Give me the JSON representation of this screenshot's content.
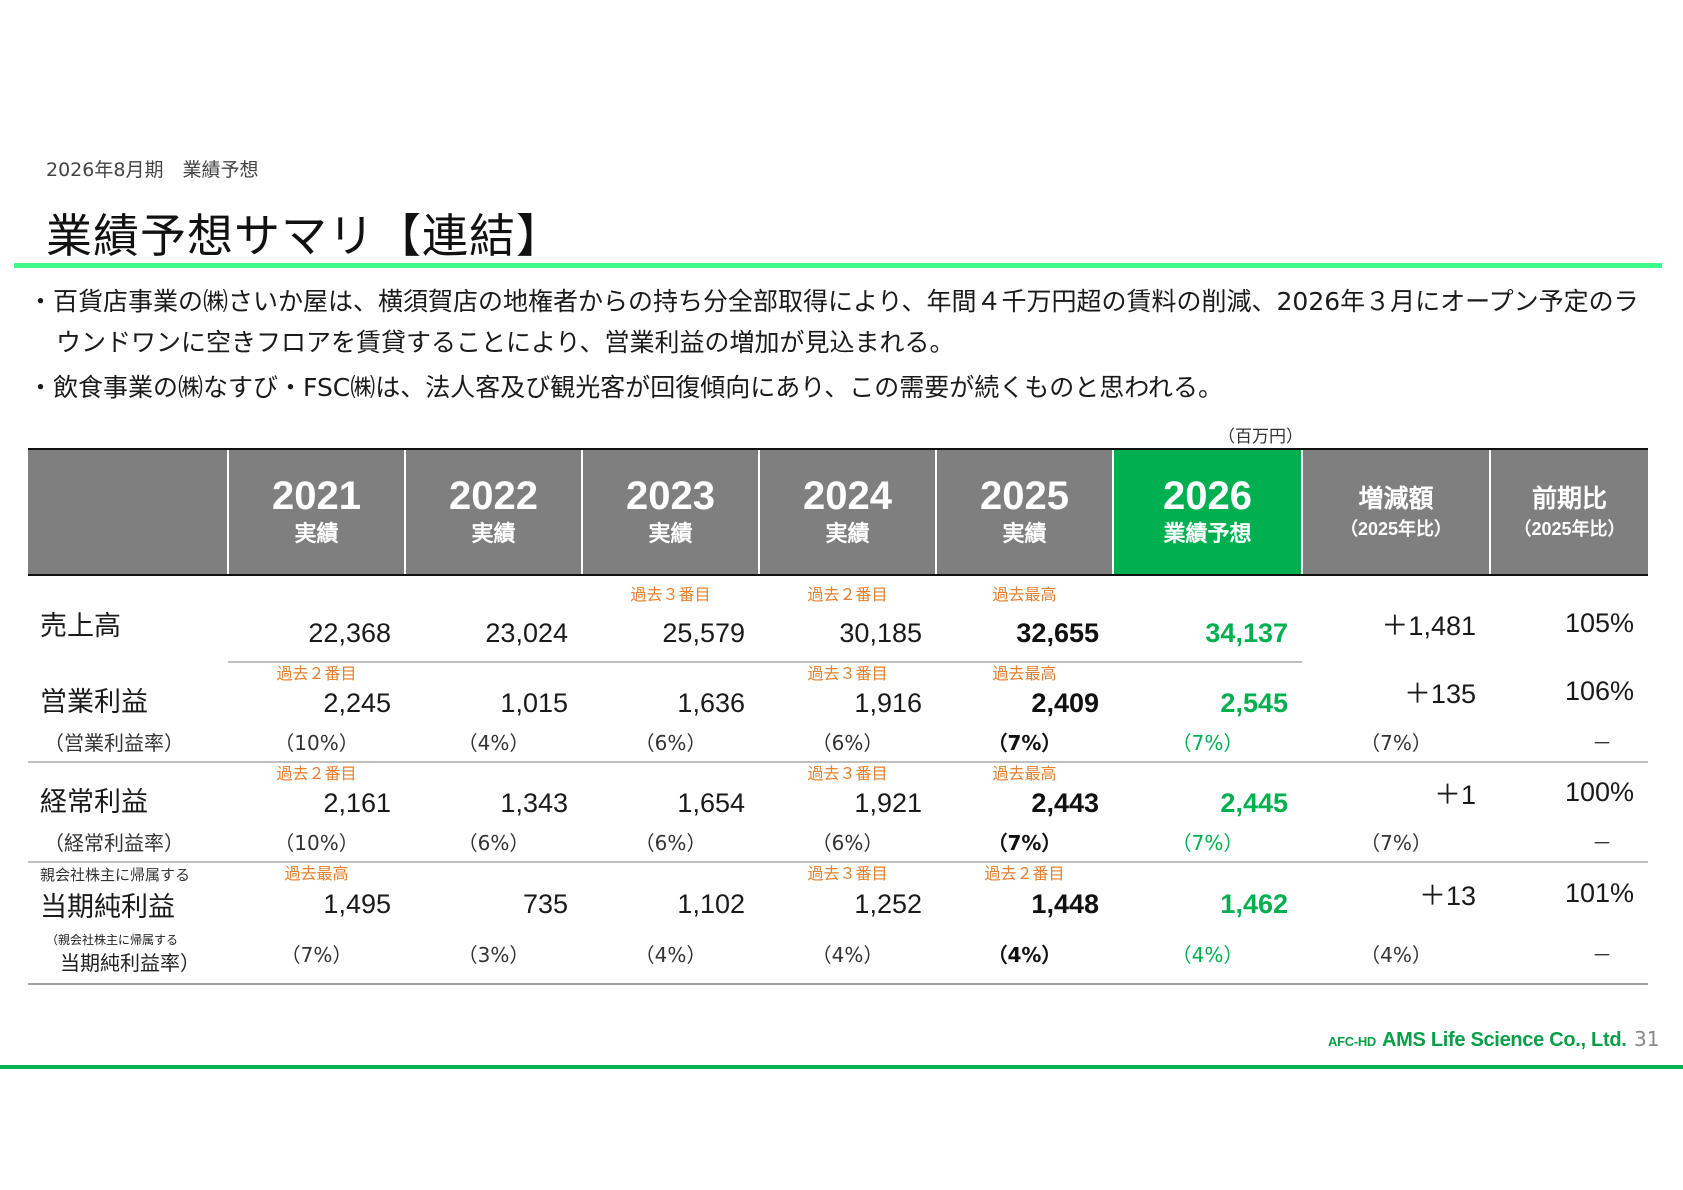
{
  "header": {
    "subtitle": "2026年8月期　業績予想",
    "title": "業績予想サマリ【連結】"
  },
  "bullets": [
    "・百貨店事業の㈱さいか屋は、横須賀店の地権者からの持ち分全部取得により、年間４千万円超の賃料の削減、2026年３月にオープン予定のラウンドワンに空きフロアを賃貸することにより、営業利益の増加が見込まれる。",
    "・飲食事業の㈱なすび・FSC㈱は、法人客及び観光客が回復傾向にあり、この需要が続くものと思われる。"
  ],
  "table": {
    "unit": "（百万円）",
    "columns": [
      {
        "year": "2021",
        "label": "実績"
      },
      {
        "year": "2022",
        "label": "実績"
      },
      {
        "year": "2023",
        "label": "実績"
      },
      {
        "year": "2024",
        "label": "実績"
      },
      {
        "year": "2025",
        "label": "実績"
      },
      {
        "year": "2026",
        "label": "業績予想"
      }
    ],
    "diff_header": {
      "label": "増減額",
      "sub": "（2025年比）"
    },
    "ratio_header": {
      "label": "前期比",
      "sub": "（2025年比）"
    },
    "rows": {
      "sales": {
        "label": "売上高",
        "notes": [
          "",
          "",
          "過去３番目",
          "過去２番目",
          "過去最高",
          ""
        ],
        "values": [
          "22,368",
          "23,024",
          "25,579",
          "30,185",
          "32,655",
          "34,137"
        ],
        "diff": "＋1,481",
        "ratio": "105%"
      },
      "op": {
        "label": "営業利益",
        "sublabel": "（営業利益率）",
        "notes": [
          "過去２番目",
          "",
          "",
          "過去３番目",
          "過去最高",
          ""
        ],
        "values": [
          "2,245",
          "1,015",
          "1,636",
          "1,916",
          "2,409",
          "2,545"
        ],
        "pcts": [
          "（10%）",
          "（4%）",
          "（6%）",
          "（6%）",
          "（7%）",
          "（7%）",
          "（7%）"
        ],
        "diff": "＋135",
        "ratio": "106%",
        "ratio_sub": "－"
      },
      "ord": {
        "label": "経常利益",
        "sublabel": "（経常利益率）",
        "notes": [
          "過去２番目",
          "",
          "",
          "過去３番目",
          "過去最高",
          ""
        ],
        "values": [
          "2,161",
          "1,343",
          "1,654",
          "1,921",
          "2,443",
          "2,445"
        ],
        "pcts": [
          "（10%）",
          "（6%）",
          "（6%）",
          "（6%）",
          "（7%）",
          "（7%）",
          "（7%）"
        ],
        "diff": "＋1",
        "ratio": "100%",
        "ratio_sub": "－"
      },
      "net": {
        "pre_label": "親会社株主に帰属する",
        "label": "当期純利益",
        "sublabel_small": "（親会社株主に帰属する",
        "sublabel2": "当期純利益率）",
        "notes": [
          "過去最高",
          "",
          "",
          "過去３番目",
          "過去２番目",
          ""
        ],
        "values": [
          "1,495",
          "735",
          "1,102",
          "1,252",
          "1,448",
          "1,462"
        ],
        "pcts": [
          "（7%）",
          "（3%）",
          "（4%）",
          "（4%）",
          "（4%）",
          "（4%）",
          "（4%）"
        ],
        "diff": "＋13",
        "ratio": "101%",
        "ratio_sub": "－"
      }
    }
  },
  "footer": {
    "logo_prefix": "AFC-HD",
    "logo_text": "AMS Life Science Co., Ltd.",
    "page_number": "31"
  },
  "colors": {
    "accent_green": "#00b050",
    "rule_green": "#3dfa8b",
    "header_gray": "#7f7f7f",
    "note_orange": "#e4802f"
  }
}
